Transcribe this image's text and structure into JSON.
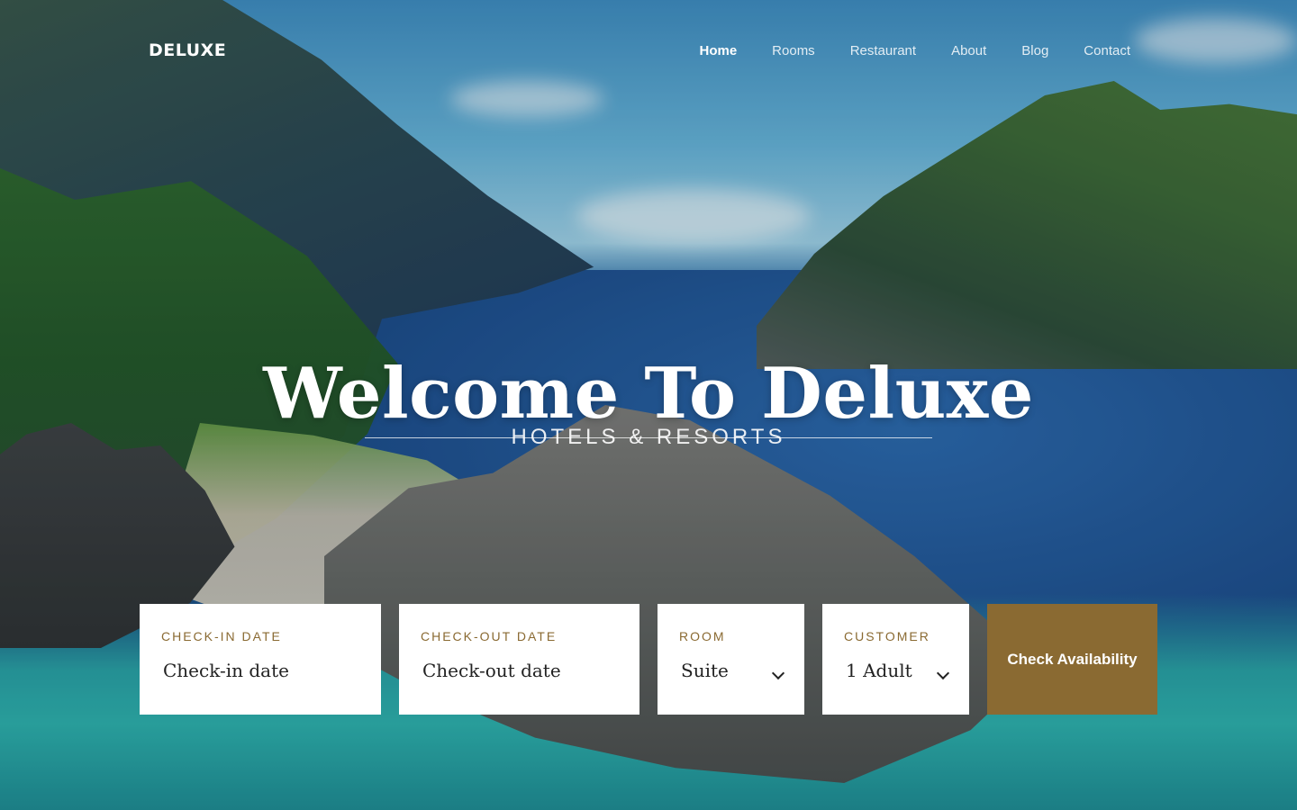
{
  "brand": {
    "name": "DELUXE"
  },
  "nav": {
    "items": [
      {
        "label": "Home",
        "active": true
      },
      {
        "label": "Rooms",
        "active": false
      },
      {
        "label": "Restaurant",
        "active": false
      },
      {
        "label": "About",
        "active": false
      },
      {
        "label": "Blog",
        "active": false
      },
      {
        "label": "Contact",
        "active": false
      }
    ]
  },
  "hero": {
    "title": "Welcome To Deluxe",
    "subtitle": "HOTELS & RESORTS",
    "background_image": "tropical-island-lagoon-photo"
  },
  "booking": {
    "checkin": {
      "label": "CHECK-IN DATE",
      "placeholder": "Check-in date",
      "value": ""
    },
    "checkout": {
      "label": "CHECK-OUT DATE",
      "placeholder": "Check-out date",
      "value": ""
    },
    "room": {
      "label": "ROOM",
      "selected": "Suite",
      "icon": "chevron-down-icon"
    },
    "customer": {
      "label": "CUSTOMER",
      "selected": "1 Adult",
      "icon": "chevron-down-icon"
    },
    "submit_label": "Check Availability"
  },
  "colors": {
    "accent": "#8a6a32",
    "text_dark": "#222222",
    "white": "#ffffff"
  }
}
